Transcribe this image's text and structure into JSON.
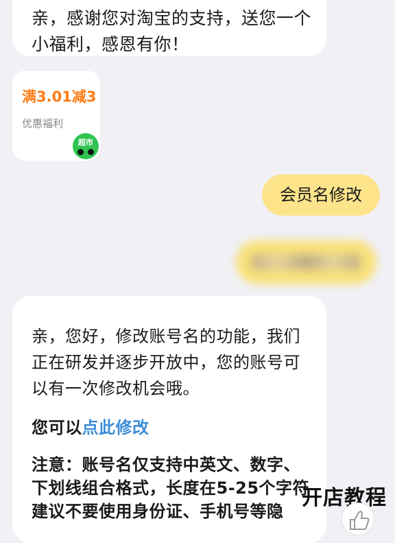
{
  "messages": {
    "greeting": "亲，感谢您对淘宝的支持，送您一个小福利，感恩有你！",
    "coupon": {
      "amount": "满3.01减3",
      "desc": "优惠福利",
      "badge": "超市"
    },
    "user_msg": "会员名修改",
    "reply": {
      "text": "亲，您好，修改账号名的功能，我们正在研发并逐步开放中，您的账号可以有一次修改机会哦。",
      "prompt_prefix": "您可以",
      "link": "点此修改",
      "notice": "注意：账号名仅支持中英文、数字、下划线组合格式，长度在5-25个字符建议不要使用身份证、手机号等隐"
    }
  },
  "watermark": "开店教程",
  "colors": {
    "background": "#f0f0f5",
    "user_bubble": "#fde48a",
    "coupon_amount": "#ff7a14",
    "link": "#3b8ed8",
    "badge": "#2fc44f"
  }
}
